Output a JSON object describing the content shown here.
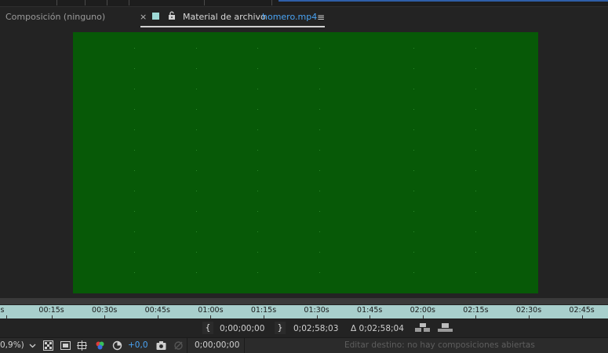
{
  "tabs": {
    "composition_tab": "Composición (ninguno)",
    "close_glyph": "×",
    "footage_label": "Material de archivo",
    "footage_file": "homero.mp4",
    "menu_glyph": "≡"
  },
  "colors": {
    "frame": "#075907",
    "ruler": "#a8cfcc",
    "link_blue": "#4aa3f3",
    "swatch": "#9fd9d6"
  },
  "ruler": {
    "ticks": [
      "s",
      "00:15s",
      "00:30s",
      "00:45s",
      "01:00s",
      "01:15s",
      "01:30s",
      "01:45s",
      "02:00s",
      "02:15s",
      "02:30s",
      "02:45s"
    ]
  },
  "timing": {
    "in_point": "0;00;00;00",
    "out_point": "0;02;58;03",
    "duration": "Δ 0;02;58;04"
  },
  "bottom": {
    "zoom": "0,9%)",
    "exposure": "+0,0",
    "current_time": "0;00;00;00",
    "status": "Editar destino: no hay composiciones abiertas"
  },
  "icons": [
    "close-icon",
    "lock-icon",
    "panel-menu-icon",
    "zoom-dropdown-icon",
    "transparency-grid-icon",
    "mask-icon",
    "safe-areas-icon",
    "color-channels-icon",
    "reset-exposure-icon",
    "snapshot-icon",
    "show-snapshot-icon",
    "in-point-bracket-icon",
    "out-point-bracket-icon",
    "ripple-insert-icon",
    "overlay-edit-icon"
  ]
}
